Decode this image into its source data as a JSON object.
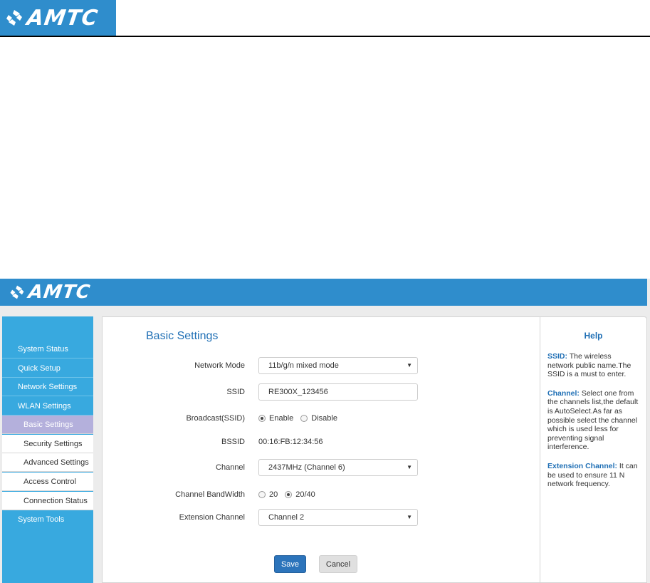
{
  "brand": {
    "name": "AMTC"
  },
  "sidebar": {
    "items": [
      {
        "label": "System Status"
      },
      {
        "label": "Quick Setup"
      },
      {
        "label": "Network Settings"
      },
      {
        "label": "WLAN Settings"
      },
      {
        "label": "Basic Settings"
      },
      {
        "label": "Security Settings"
      },
      {
        "label": "Advanced Settings"
      },
      {
        "label": "Access Control"
      },
      {
        "label": "Connection Status"
      },
      {
        "label": "System Tools"
      }
    ]
  },
  "main": {
    "title": "Basic Settings",
    "network_mode": {
      "label": "Network Mode",
      "value": "11b/g/n mixed mode"
    },
    "ssid": {
      "label": "SSID",
      "value": "RE300X_123456"
    },
    "broadcast": {
      "label": "Broadcast(SSID)",
      "options": [
        "Enable",
        "Disable"
      ],
      "selected": "Enable"
    },
    "bssid": {
      "label": "BSSID",
      "value": "00:16:FB:12:34:56"
    },
    "channel": {
      "label": "Channel",
      "value": "2437MHz (Channel 6)"
    },
    "bandwidth": {
      "label": "Channel BandWidth",
      "options": [
        "20",
        "20/40"
      ],
      "selected": "20/40"
    },
    "extension_channel": {
      "label": "Extension Channel",
      "value": "Channel 2"
    },
    "save_label": "Save",
    "cancel_label": "Cancel"
  },
  "help": {
    "title": "Help",
    "entries": [
      {
        "key": "SSID:",
        "text": " The wireless network public name.The SSID is a must to enter."
      },
      {
        "key": "Channel:",
        "text": " Select one from the channels list,the default is AutoSelect.As far as possible select the channel which is used less for preventing signal interference."
      },
      {
        "key": "Extension Channel:",
        "text": " It can be used to ensure 11 N network frequency."
      }
    ]
  },
  "colors": {
    "brand_blue": "#2f8dcc",
    "sidebar_blue": "#38a9df",
    "active_item": "#b4b0dc",
    "title_blue": "#1f6fb5",
    "save_button": "#2c74bb"
  },
  "icons": {
    "logo": "amtc-logo-icon",
    "select_caret": "caret-down-icon"
  }
}
